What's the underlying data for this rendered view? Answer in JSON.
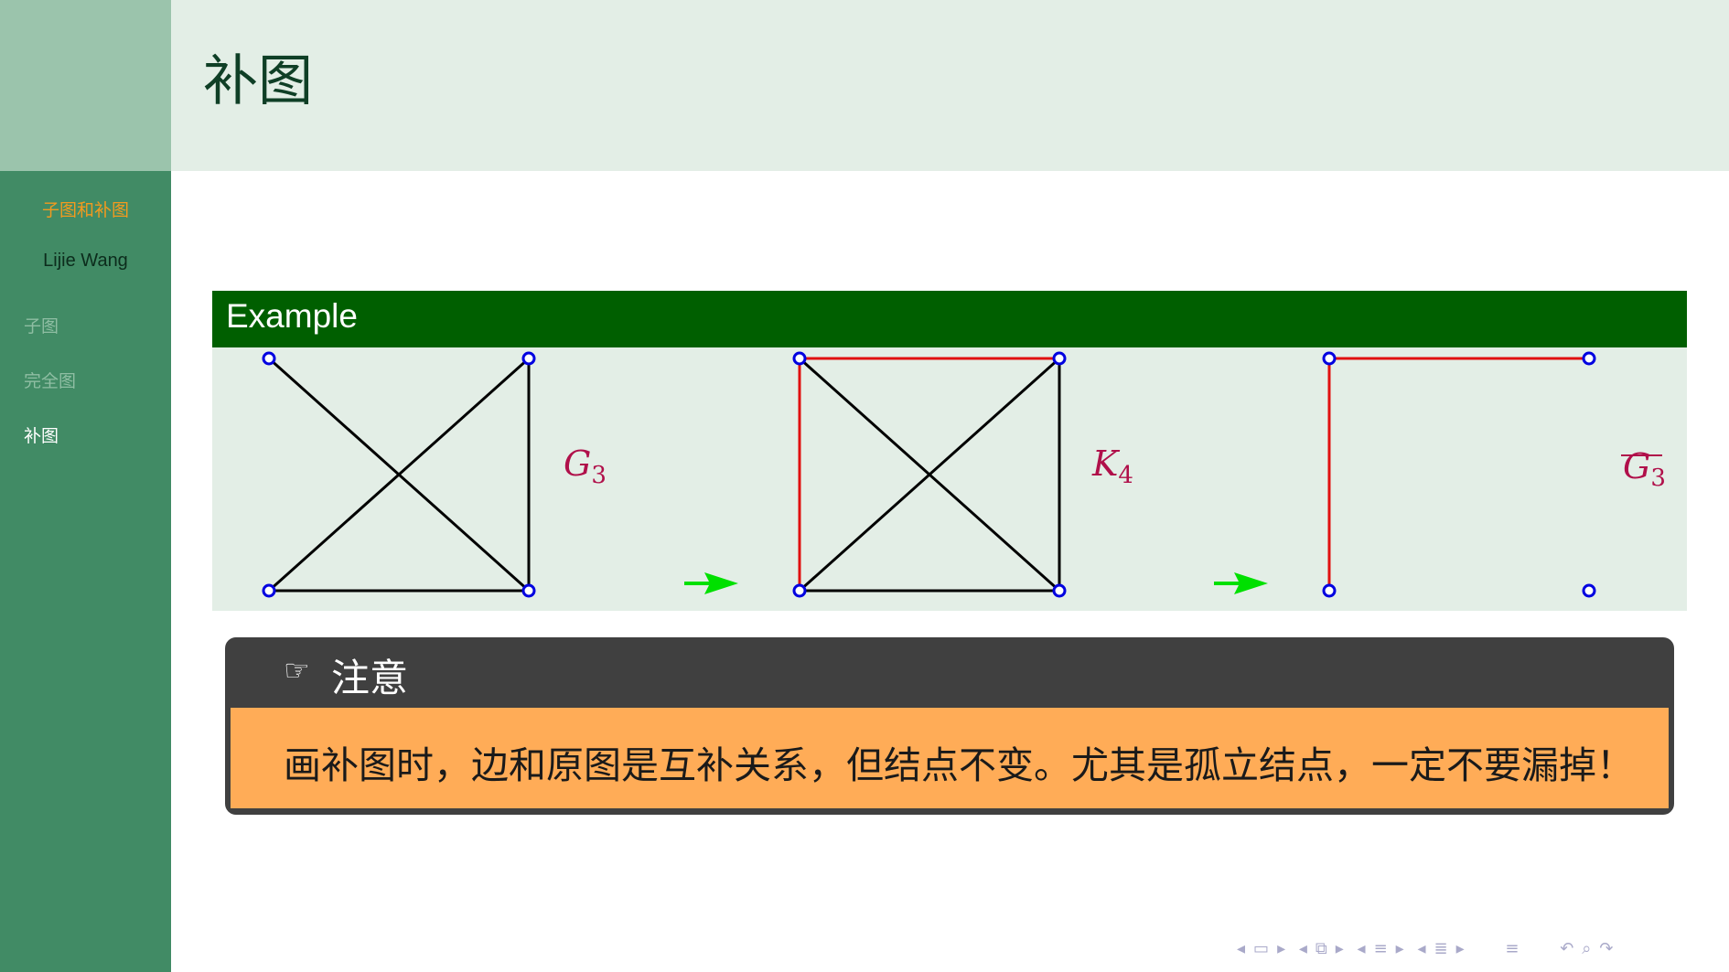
{
  "sidebar": {
    "deck_title": "子图和补图",
    "author": "Lijie Wang",
    "items": [
      {
        "label": "子图",
        "active": false
      },
      {
        "label": "完全图",
        "active": false
      },
      {
        "label": "补图",
        "active": true
      }
    ]
  },
  "header": {
    "title": "补图"
  },
  "example": {
    "title": "Example",
    "graph_labels": {
      "g3": {
        "base": "G",
        "sub": "3"
      },
      "k4": {
        "base": "K",
        "sub": "4"
      },
      "g3_complement": {
        "base": "G",
        "sub": "3"
      }
    },
    "colors": {
      "edge": "#000000",
      "edge_highlight": "#e01010",
      "vertex": "#0000e0",
      "arrow": "#00e000",
      "label": "#b0104a"
    }
  },
  "note": {
    "icon": "pointing-hand-icon",
    "title": "注意",
    "text": "画补图时，边和原图是互补关系，但结点不变。尤其是孤立结点，一定不要漏掉！"
  },
  "nav_controls": {
    "icons": [
      "prev-arrow-icon",
      "frame-icon",
      "next-arrow-icon",
      "prev-arrow-icon",
      "subsection-icon",
      "next-arrow-icon",
      "prev-arrow-icon",
      "section-icon",
      "next-arrow-icon",
      "prev-arrow-icon",
      "appendix-icon",
      "next-arrow-icon",
      "toc-icon",
      "back-icon",
      "search-icon",
      "forward-icon"
    ]
  }
}
